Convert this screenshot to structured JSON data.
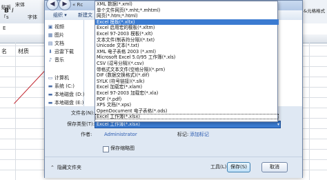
{
  "sheet": {
    "font_name": "宋体",
    "clipboard_label": "贴板",
    "clipboard_suffix": "「s",
    "font_group": "字体",
    "name_box_fragment": "E",
    "column_b_label": "名",
    "column_c_label": "材质",
    "ribbon_right_label": "&元格格式"
  },
  "dialog": {
    "address_fragment": "« Rc",
    "toolbar": {
      "organize": "组织 ▾",
      "new_folder": "新建文"
    },
    "nav_items": [
      {
        "label": "视频",
        "icon": "video-icon"
      },
      {
        "label": "图片",
        "icon": "pictures-icon"
      },
      {
        "label": "文档",
        "icon": "documents-icon"
      },
      {
        "label": "迅雷下载",
        "icon": "download-icon"
      },
      {
        "label": "音乐",
        "icon": "music-icon"
      },
      {
        "label": "计算机",
        "icon": "computer-icon"
      },
      {
        "label": "系统 (C:)",
        "icon": "drive-icon"
      },
      {
        "label": "本地磁盘 (D:)",
        "icon": "drive-icon"
      },
      {
        "label": "本地磁盘 (E:)",
        "icon": "drive-icon"
      }
    ],
    "type_options": [
      "XML 数据(*.xml)",
      "单个文件网页(*.mht;*.mhtml)",
      "网页(*.htm;*.html)",
      "Excel 模板(*.xltx)",
      "Excel 启用宏的模板(*.xltm)",
      "Excel 97-2003 模板(*.xlt)",
      "文本文件(制表符分隔)(*.txt)",
      "Unicode 文本(*.txt)",
      "XML 电子表格 2003 (*.xml)",
      "Microsoft Excel 5.0/95 工作簿(*.xls)",
      "CSV (逗号分隔)(*.csv)",
      "带格式文本文件(空格分隔)(*.prn)",
      "DIF (数据交换格式)(*.dif)",
      "SYLK (符号链接)(*.slk)",
      "Excel 加载宏(*.xlam)",
      "Excel 97-2003 加载宏(*.xla)",
      "PDF (*.pdf)",
      "XPS 文档(*.xps)",
      "OpenDocument 电子表格(*.ods)",
      "Excel 工作簿(*.xlsx)"
    ],
    "selected_index": 3,
    "filename_label": "文件名(N):",
    "savetype_label": "保存类型(T):",
    "savetype_value": "Excel 工作簿(*.xlsx)",
    "author_label": "作者:",
    "author_value": "Administrator",
    "tags_label": "标记:",
    "tags_value": "添加标记",
    "thumbnail_label": "保存缩略图",
    "hide_folders": "隐藏文件夹",
    "tools_label": "工具(L)",
    "save_label": "保存(S)",
    "cancel_label": "取消"
  }
}
